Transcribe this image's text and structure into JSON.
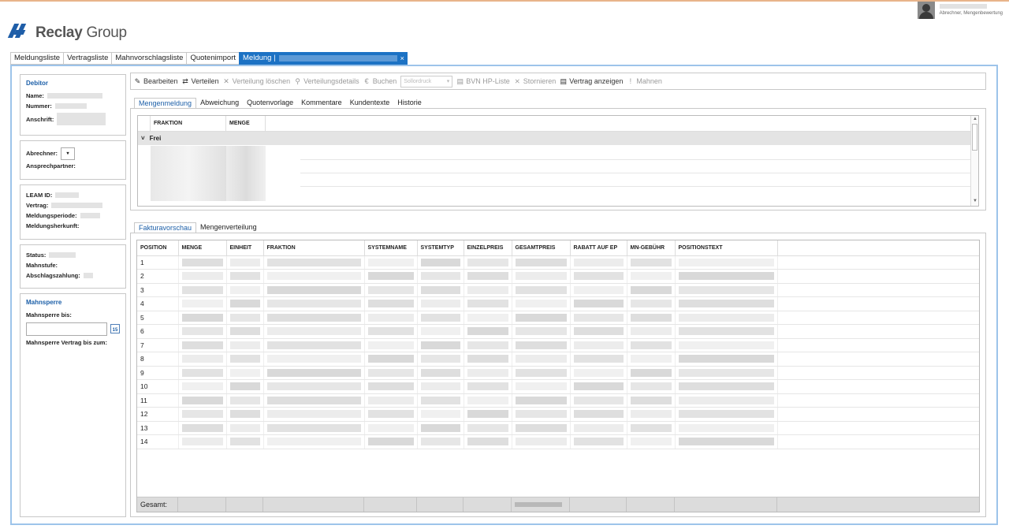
{
  "user": {
    "role": "Abrechner, Mengenbewertung"
  },
  "logo": {
    "brand": "Reclay",
    "suffix": "Group"
  },
  "tabs": [
    {
      "label": "Meldungsliste"
    },
    {
      "label": "Vertragsliste"
    },
    {
      "label": "Mahnvorschlagsliste"
    },
    {
      "label": "Quotenimport"
    }
  ],
  "active_tab": {
    "label": "Meldung |",
    "close": "×"
  },
  "debitor": {
    "heading": "Debitor",
    "name_label": "Name:",
    "nummer_label": "Nummer:",
    "anschrift_label": "Anschrift:"
  },
  "abrechner": {
    "label": "Abrechner:",
    "combo": "▾",
    "ansprech_label": "Ansprechpartner:"
  },
  "contract": {
    "leam_label": "LEAM ID:",
    "vertrag_label": "Vertrag:",
    "periode_label": "Meldungsperiode:",
    "herkunft_label": "Meldungsherkunft:"
  },
  "status": {
    "status_label": "Status:",
    "mahnstufe_label": "Mahnstufe:",
    "abschlag_label": "Abschlagszahlung:"
  },
  "mahnsperre": {
    "heading": "Mahnsperre",
    "bis_label": "Mahnsperre bis:",
    "cal": "15",
    "vertrag_label": "Mahnsperre Vertrag bis zum:"
  },
  "toolbar": {
    "bearbeiten": "Bearbeiten",
    "verteilen": "Verteilen",
    "verteilung_loeschen": "Verteilung löschen",
    "verteilungsdetails": "Verteilungsdetails",
    "buchen": "Buchen",
    "sortiment": "Sollordruck",
    "bvn": "BVN HP-Liste",
    "stornieren": "Stornieren",
    "vertrag_anzeigen": "Vertrag anzeigen",
    "mahnen": "Mahnen"
  },
  "upper_tabs": [
    "Mengenmeldung",
    "Abweichung",
    "Quotenvorlage",
    "Kommentare",
    "Kundentexte",
    "Historie"
  ],
  "upper_grid": {
    "columns": [
      "FRAKTION",
      "MENGE"
    ],
    "group": "Frei",
    "group_toggle": "˅"
  },
  "lower_tabs": [
    "Fakturavorschau",
    "Mengenverteilung"
  ],
  "lower_grid": {
    "columns": [
      "POSITION",
      "MENGE",
      "EINHEIT",
      "FRAKTION",
      "SYSTEMNAME",
      "SYSTEMTYP",
      "EINZELPREIS",
      "GESAMTPREIS",
      "RABATT AUF EP",
      "MN-GEBÜHR",
      "POSITIONSTEXT"
    ],
    "positions": [
      "1",
      "2",
      "3",
      "4",
      "5",
      "6",
      "7",
      "8",
      "9",
      "10",
      "11",
      "12",
      "13",
      "14"
    ],
    "total_label": "Gesamt:"
  },
  "colors": {
    "accent": "#1c72c4",
    "heading": "#1c5fa8",
    "border": "#9dc4ea"
  }
}
